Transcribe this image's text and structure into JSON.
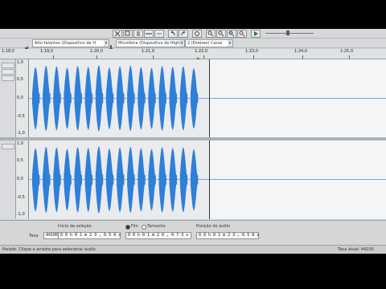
{
  "toolbar": {
    "recording_device": "Alto-falantes (Dispositivo de H",
    "input_device": "Microfone (Dispositivo de High",
    "channels": "2 (Estéreo) Canai"
  },
  "ruler": {
    "labels": [
      "1:18,0",
      "1:19,0",
      "1:20,0",
      "1:21,0",
      "1:22,0",
      "1:23,0",
      "1:24,0",
      "1:25,0"
    ]
  },
  "tracks": [
    {
      "scale_labels": [
        "1,0",
        "0,5",
        "0,0",
        "-0,5",
        "-1,0"
      ]
    },
    {
      "scale_labels": [
        "1,0",
        "0,5",
        "0,0",
        "-0,5",
        "-1,0"
      ]
    }
  ],
  "waveform": {
    "color": "#2f7fd6",
    "bursts": [
      0.88,
      0.92,
      0.9,
      0.86,
      0.91,
      0.89,
      0.93,
      0.87,
      0.9,
      0.92,
      0.88,
      0.86,
      0.91,
      0.89,
      0.9,
      0.85
    ]
  },
  "selection": {
    "rate_label": "Taxa",
    "rate_value": "44100",
    "start_label": "Início da seleção",
    "start_value": "0 0 h 0 1 m 2 3 , 6 5 0 s",
    "end_label": "Fim",
    "length_label": "Tamanho",
    "end_value": "0 0 h 0 1 m 2 6 , 0 7 3 s",
    "position_label": "Posição do áudio",
    "position_value": "0 0 h 0 1 m 2 3 , 6 5 8 s"
  },
  "status": {
    "left_text": "Parado. Clique e arraste para selecionar áudio",
    "right_text": "Taxa atual: 44100"
  }
}
